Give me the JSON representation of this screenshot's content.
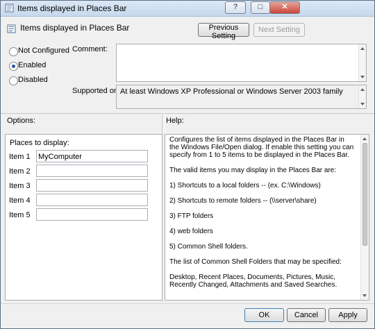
{
  "window": {
    "title": "Items displayed in Places Bar",
    "caption_buttons": [
      "?",
      "□",
      "✕"
    ]
  },
  "setting": {
    "name": "Items displayed in Places Bar",
    "previous_button": "Previous Setting",
    "next_button": "Next Setting"
  },
  "state": {
    "options": [
      {
        "label": "Not Configured",
        "selected": false
      },
      {
        "label": "Enabled",
        "selected": true
      },
      {
        "label": "Disabled",
        "selected": false
      }
    ]
  },
  "comment": {
    "label": "Comment:",
    "value": ""
  },
  "supported_on": {
    "label": "Supported on:",
    "value": "At least Windows XP Professional or Windows Server 2003 family"
  },
  "options_panel": {
    "header": "Options:",
    "group_label": "Places to display:",
    "items": [
      {
        "label": "Item 1",
        "value": "MyComputer"
      },
      {
        "label": "Item 2",
        "value": ""
      },
      {
        "label": "Item 3",
        "value": ""
      },
      {
        "label": "Item 4",
        "value": ""
      },
      {
        "label": "Item 5",
        "value": ""
      }
    ]
  },
  "help_panel": {
    "header": "Help:",
    "text": "Configures the list of items displayed in the Places Bar in the Windows File/Open dialog. If enable this setting you can specify from 1 to 5 items to be displayed in the Places Bar.\n\nThe valid items you may display in the Places Bar are:\n\n1) Shortcuts to a local folders -- (ex. C:\\Windows)\n\n2) Shortcuts to remote folders -- (\\\\server\\share)\n\n3) FTP folders\n\n4) web folders\n\n5) Common Shell folders.\n\nThe list of Common Shell Folders that may be specified:\n\nDesktop, Recent Places, Documents, Pictures, Music, Recently Changed, Attachments and Saved Searches."
  },
  "footer": {
    "ok": "OK",
    "cancel": "Cancel",
    "apply": "Apply"
  },
  "colors": {
    "titlebar": "#c7d9ee",
    "dialog_background": "#f0f0f0",
    "selected_radio": "#2b56a8"
  }
}
